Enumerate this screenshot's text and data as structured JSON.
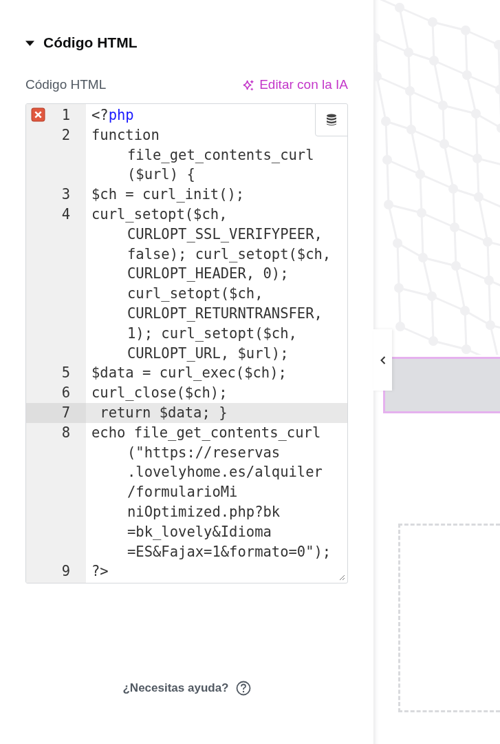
{
  "section": {
    "title": "Código HTML",
    "expanded": true
  },
  "field": {
    "label": "Código HTML",
    "ai_link": "Editar con la IA"
  },
  "editor": {
    "lines": [
      {
        "number": "1",
        "error": true,
        "active": false,
        "rows": [
          [
            {
              "text": "<?",
              "kind": "plain"
            },
            {
              "text": "php",
              "kind": "keyword"
            }
          ]
        ]
      },
      {
        "number": "2",
        "error": false,
        "active": false,
        "rows": [
          [
            {
              "text": "function",
              "kind": "plain"
            }
          ],
          [
            {
              "text": "file_get_contents_curl",
              "kind": "plain"
            }
          ],
          [
            {
              "text": "($url) {",
              "kind": "plain"
            }
          ]
        ]
      },
      {
        "number": "3",
        "error": false,
        "active": false,
        "rows": [
          [
            {
              "text": "$ch = curl_init();",
              "kind": "plain"
            }
          ]
        ]
      },
      {
        "number": "4",
        "error": false,
        "active": false,
        "rows": [
          [
            {
              "text": "curl_setopt($ch,",
              "kind": "plain"
            }
          ],
          [
            {
              "text": "CURLOPT_SSL_VERIFYPEER,",
              "kind": "plain"
            }
          ],
          [
            {
              "text": "false); curl_setopt($ch,",
              "kind": "plain"
            }
          ],
          [
            {
              "text": "CURLOPT_HEADER, 0);",
              "kind": "plain"
            }
          ],
          [
            {
              "text": "curl_setopt($ch,",
              "kind": "plain"
            }
          ],
          [
            {
              "text": "CURLOPT_RETURNTRANSFER,",
              "kind": "plain"
            }
          ],
          [
            {
              "text": "1); curl_setopt($ch,",
              "kind": "plain"
            }
          ],
          [
            {
              "text": "CURLOPT_URL, $url);",
              "kind": "plain"
            }
          ]
        ]
      },
      {
        "number": "5",
        "error": false,
        "active": false,
        "rows": [
          [
            {
              "text": "$data = curl_exec($ch);",
              "kind": "plain"
            }
          ]
        ]
      },
      {
        "number": "6",
        "error": false,
        "active": false,
        "rows": [
          [
            {
              "text": "curl_close($ch);",
              "kind": "plain"
            }
          ]
        ]
      },
      {
        "number": "7",
        "error": false,
        "active": true,
        "rows": [
          [
            {
              "text": " return $data; }",
              "kind": "plain"
            }
          ]
        ]
      },
      {
        "number": "8",
        "error": false,
        "active": false,
        "rows": [
          [
            {
              "text": "echo file_get_contents_curl",
              "kind": "plain"
            }
          ],
          [
            {
              "text": "(\"https://reservas",
              "kind": "plain"
            }
          ],
          [
            {
              "text": ".lovelyhome.es/alquiler",
              "kind": "plain"
            }
          ],
          [
            {
              "text": "/formularioMi",
              "kind": "plain"
            }
          ],
          [
            {
              "text": "niOptimized.php?bk",
              "kind": "plain"
            }
          ],
          [
            {
              "text": "=bk_lovely&Idioma",
              "kind": "plain"
            }
          ],
          [
            {
              "text": "=ES&Fajax=1&formato=0\");",
              "kind": "plain"
            }
          ]
        ]
      },
      {
        "number": "9",
        "error": false,
        "active": false,
        "rows": [
          [
            {
              "text": "?>",
              "kind": "plain"
            }
          ]
        ]
      }
    ]
  },
  "help": "¿Necesitas ayuda?"
}
